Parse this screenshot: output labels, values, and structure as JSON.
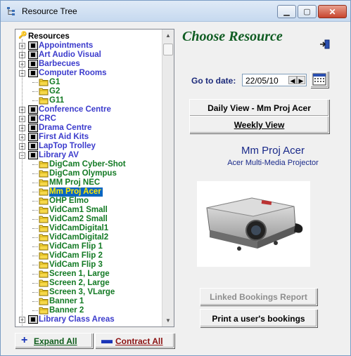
{
  "window": {
    "title": "Resource Tree"
  },
  "titlebar_buttons": {
    "minimize": "▁",
    "maximize": "▢",
    "close": "✕"
  },
  "tree": {
    "root": "Resources",
    "items": [
      {
        "label": "Appointments",
        "level": 1,
        "state": "collapsed"
      },
      {
        "label": "Art Audio Visual",
        "level": 1,
        "state": "collapsed"
      },
      {
        "label": "Barbecues",
        "level": 1,
        "state": "collapsed"
      },
      {
        "label": "Computer Rooms",
        "level": 1,
        "state": "expanded"
      },
      {
        "label": "G1",
        "level": 2
      },
      {
        "label": "G2",
        "level": 2
      },
      {
        "label": "G11",
        "level": 2
      },
      {
        "label": "Conference Centre",
        "level": 1,
        "state": "collapsed"
      },
      {
        "label": "CRC",
        "level": 1,
        "state": "collapsed"
      },
      {
        "label": "Drama Centre",
        "level": 1,
        "state": "collapsed"
      },
      {
        "label": "First Aid Kits",
        "level": 1,
        "state": "collapsed"
      },
      {
        "label": "LapTop Trolley",
        "level": 1,
        "state": "collapsed"
      },
      {
        "label": "Library AV",
        "level": 1,
        "state": "expanded"
      },
      {
        "label": "DigCam Cyber-Shot",
        "level": 2
      },
      {
        "label": "DigCam Olympus",
        "level": 2
      },
      {
        "label": "MM Proj NEC",
        "level": 2
      },
      {
        "label": "Mm Proj Acer",
        "level": 2,
        "selected": true
      },
      {
        "label": "OHP Elmo",
        "level": 2
      },
      {
        "label": "VidCam1 Small",
        "level": 2
      },
      {
        "label": "VidCam2 Small",
        "level": 2
      },
      {
        "label": "VidCamDigital1",
        "level": 2
      },
      {
        "label": "VidCamDigital2",
        "level": 2
      },
      {
        "label": "VidCam Flip 1",
        "level": 2
      },
      {
        "label": "VidCam Flip 2",
        "level": 2
      },
      {
        "label": "VidCam Flip 3",
        "level": 2
      },
      {
        "label": "Screen 1, Large",
        "level": 2
      },
      {
        "label": "Screen 2, Large",
        "level": 2
      },
      {
        "label": "Screen 3, VLarge",
        "level": 2
      },
      {
        "label": "Banner 1",
        "level": 2
      },
      {
        "label": "Banner 2",
        "level": 2
      },
      {
        "label": "Library Class Areas",
        "level": 1,
        "state": "collapsed"
      }
    ]
  },
  "buttons": {
    "expand_all": "Expand All",
    "expand_icon": "+",
    "contract_all": "Contract All",
    "contract_icon": "▬"
  },
  "panel": {
    "heading": "Choose Resource",
    "goto_label": "Go to date:",
    "date_value": "22/05/10",
    "date_prev": "◀",
    "date_next": "▶",
    "daily_view": "Daily View - Mm Proj Acer",
    "weekly_view": "Weekly View",
    "resource_name": "Mm Proj Acer",
    "resource_description": "Acer Multi-Media Projector",
    "linked_report": "Linked Bookings Report",
    "print_bookings": "Print a user's bookings"
  },
  "colors": {
    "heading": "#0f5c22",
    "level1_text": "#3b3bcc",
    "level2_text": "#137a24",
    "selected_bg": "#0a66c2",
    "selected_text": "#ffea00",
    "resource_text": "#1a2a8a"
  },
  "icons": {
    "title": "resource-tree-icon",
    "exit": "exit-door-icon",
    "calendar": "calendar-icon",
    "folder": "folder-icon",
    "category": "category-box-icon"
  }
}
